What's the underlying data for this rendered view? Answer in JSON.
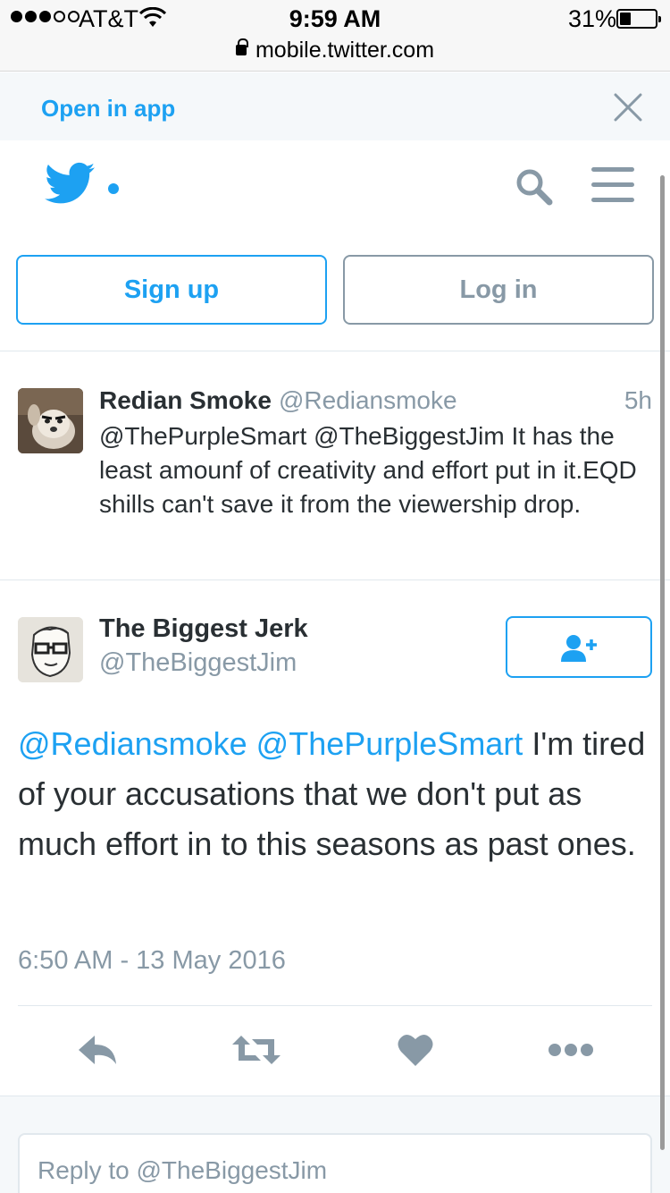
{
  "status_bar": {
    "carrier": "AT&T",
    "time": "9:59 AM",
    "battery": "31%",
    "url": "mobile.twitter.com"
  },
  "app_banner": {
    "open_label": "Open in app"
  },
  "auth": {
    "signup_label": "Sign up",
    "login_label": "Log in"
  },
  "tweets": [
    {
      "name": "Redian Smoke",
      "handle": "@Rediansmoke",
      "time": "5h",
      "text": "@ThePurpleSmart @TheBiggestJim It has the least amounf of creativity and effort put in it.EQD shills can't save it from the viewership drop."
    },
    {
      "name": "The Biggest Jerk",
      "handle": "@TheBiggestJim",
      "mentions": "@Rediansmoke @ThePurpleSmart",
      "text": " I'm tired of your accusations that we don't put as much effort in to this seasons as past ones.",
      "timestamp": "6:50 AM - 13 May 2016"
    }
  ],
  "reply": {
    "placeholder": "Reply to @TheBiggestJim"
  },
  "colors": {
    "accent": "#1da1f2",
    "muted": "#8899a6",
    "text": "#292f33"
  },
  "icons": [
    "wifi-icon",
    "lock-icon",
    "close-icon",
    "twitter-bird-icon",
    "search-icon",
    "menu-icon",
    "follow-icon",
    "reply-icon",
    "retweet-icon",
    "like-icon",
    "more-icon"
  ]
}
